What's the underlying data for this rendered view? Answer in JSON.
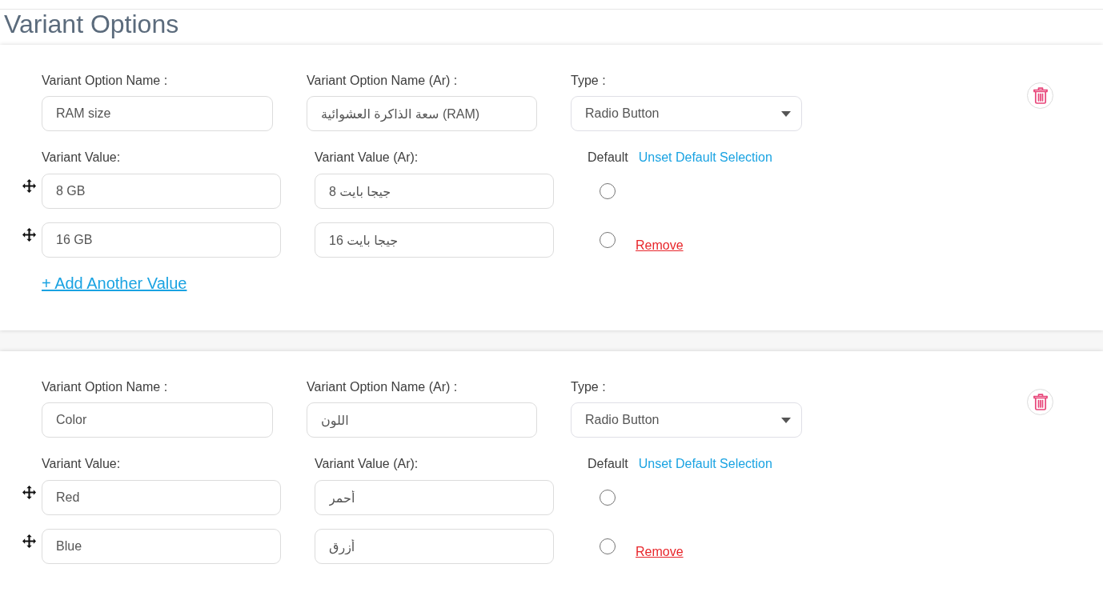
{
  "page": {
    "title": "Variant Options"
  },
  "options": [
    {
      "name_label": "Variant Option Name :",
      "name": "RAM size",
      "name_ar_label": "Variant Option Name (Ar) :",
      "name_ar": "سعة الذاكرة العشوائية (RAM)",
      "type_label": "Type :",
      "type": "Radio Button",
      "value_label": "Variant Value:",
      "value_ar_label": "Variant Value (Ar):",
      "default_label": "Default",
      "unset_default": "Unset Default Selection",
      "values": [
        {
          "value": "8 GB",
          "value_ar": "8 جيجا بايت",
          "selected": false
        },
        {
          "value": "16 GB",
          "value_ar": "16 جيجا بايت",
          "selected": false,
          "remove": "Remove"
        }
      ],
      "add_value": "+ Add Another Value"
    },
    {
      "name_label": "Variant Option Name :",
      "name": "Color",
      "name_ar_label": "Variant Option Name (Ar) :",
      "name_ar": "اللون",
      "type_label": "Type :",
      "type": "Radio Button",
      "value_label": "Variant Value:",
      "value_ar_label": "Variant Value (Ar):",
      "default_label": "Default",
      "unset_default": "Unset Default Selection",
      "values": [
        {
          "value": "Red",
          "value_ar": "أحمر",
          "selected": false
        },
        {
          "value": "Blue",
          "value_ar": "أزرق",
          "selected": false,
          "remove": "Remove"
        }
      ]
    }
  ]
}
